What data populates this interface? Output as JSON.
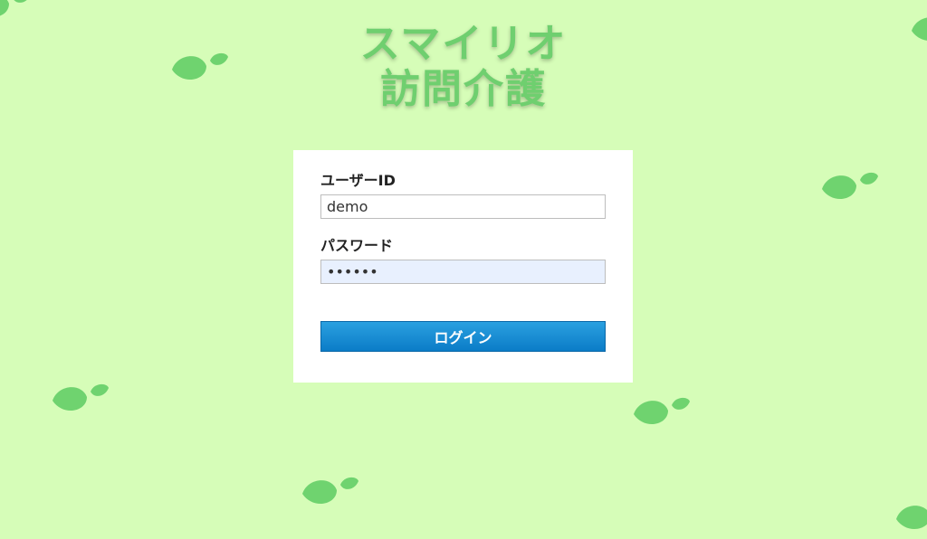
{
  "app": {
    "logo_line1": "スマイリオ",
    "logo_line2": "訪問介護"
  },
  "login_form": {
    "user_id_label": "ユーザーID",
    "user_id_value": "demo",
    "password_label": "パスワード",
    "password_value": "123456",
    "submit_label": "ログイン"
  },
  "colors": {
    "background": "#d6fdb8",
    "logo_text": "#6fcf6f",
    "leaf": "#6fd36f",
    "button": "#0b7cc7",
    "password_field_bg": "#e8f0fe"
  },
  "decorations": {
    "icon": "leaf-icon"
  }
}
